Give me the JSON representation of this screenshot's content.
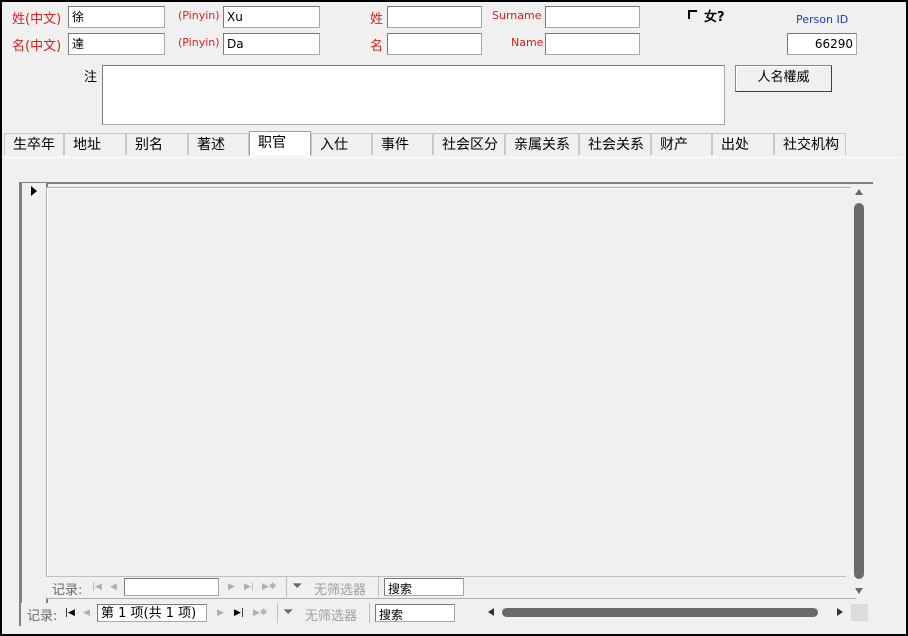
{
  "header": {
    "cn_surname_label": "姓(中文)",
    "cn_surname_value": "徐",
    "cn_given_label": "名(中文)",
    "cn_given_value": "達",
    "pinyin_label": "(Pinyin)",
    "pinyin_surname_value": "Xu",
    "pinyin_given_value": "Da",
    "xing_label": "姓",
    "xing_value": "",
    "ming_label": "名",
    "ming_value": "",
    "surname_label": "Surname",
    "surname_value": "",
    "name_label": "Name",
    "name_value": "",
    "female_label": "女?",
    "female_checked": false,
    "person_id_label": "Person ID",
    "person_id_value": "66290"
  },
  "notes": {
    "label": "注",
    "value": "",
    "authority_button": "人名權威"
  },
  "tabs": [
    "生卒年",
    "地址",
    "别名",
    "著述",
    "职官",
    "入仕",
    "事件",
    "社会区分",
    "亲属关系",
    "社会关系",
    "财产",
    "出处",
    "社交机构"
  ],
  "active_tab": "职官",
  "inner_nav": {
    "records_label": "记录:",
    "record_value": "",
    "filter_label": "无筛选器",
    "search_value": "搜索"
  },
  "outer_nav": {
    "records_label": "记录:",
    "record_value": "第 1 项(共 1 项)",
    "filter_label": "无筛选器",
    "search_value": "搜索"
  },
  "colors": {
    "label_red": "#e0201c",
    "label_blue": "#1a3cd0",
    "background": "#f0f0f0"
  }
}
